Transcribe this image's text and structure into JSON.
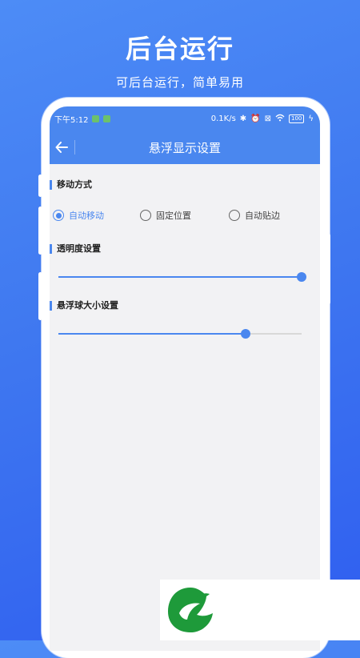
{
  "promo": {
    "title": "后台运行",
    "subtitle": "可后台运行，简单易用"
  },
  "statusbar": {
    "time": "下午5:12",
    "net_speed": "0.1K/s",
    "battery": "100",
    "icons": [
      "bluetooth-icon",
      "alarm-icon",
      "sim-icon",
      "wifi-icon",
      "battery-icon",
      "charging-icon"
    ]
  },
  "appbar": {
    "title": "悬浮显示设置",
    "back_icon": "arrow-left-icon"
  },
  "move_mode": {
    "label": "移动方式",
    "options": [
      {
        "label": "自动移动",
        "selected": true
      },
      {
        "label": "固定位置",
        "selected": false
      },
      {
        "label": "自动贴边",
        "selected": false
      }
    ]
  },
  "opacity": {
    "label": "透明度设置",
    "value_fraction": 1.0
  },
  "ball_size": {
    "label": "悬浮球大小设置",
    "value_fraction": 0.77
  },
  "colors": {
    "accent": "#4a87ef",
    "logo_green": "#1e9a3a"
  }
}
